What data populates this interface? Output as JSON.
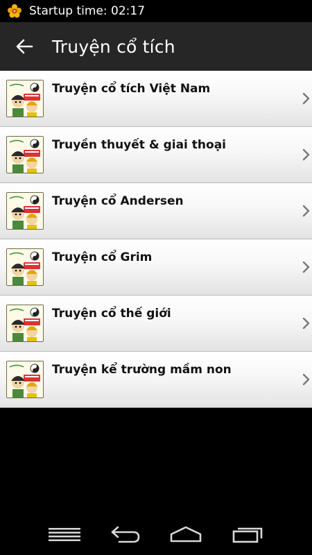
{
  "status_bar": {
    "app_icon": "flower-icon",
    "text": "Startup time: 02:17"
  },
  "action_bar": {
    "back_icon": "arrow-left-icon",
    "title": "Truyện cổ tích"
  },
  "list": {
    "items": [
      {
        "label": "Truyện cổ tích Việt Nam",
        "icon": "book-cover-thumbnail"
      },
      {
        "label": "Truyền thuyết & giai thoại",
        "icon": "book-cover-thumbnail"
      },
      {
        "label": "Truyện cổ Andersen",
        "icon": "book-cover-thumbnail"
      },
      {
        "label": "Truyện cổ Grim",
        "icon": "book-cover-thumbnail"
      },
      {
        "label": "Truyện cổ thế giới",
        "icon": "book-cover-thumbnail"
      },
      {
        "label": "Truyện kể trường mầm non",
        "icon": "book-cover-thumbnail"
      }
    ]
  },
  "nav_bar": {
    "buttons": [
      "menu-icon",
      "back-icon",
      "home-icon",
      "recent-apps-icon"
    ]
  },
  "colors": {
    "action_bar": "#262626",
    "background": "#000000",
    "list_item_top": "#ffffff",
    "list_item_bottom": "#e3e3e3",
    "divider": "#b9b9b9"
  }
}
